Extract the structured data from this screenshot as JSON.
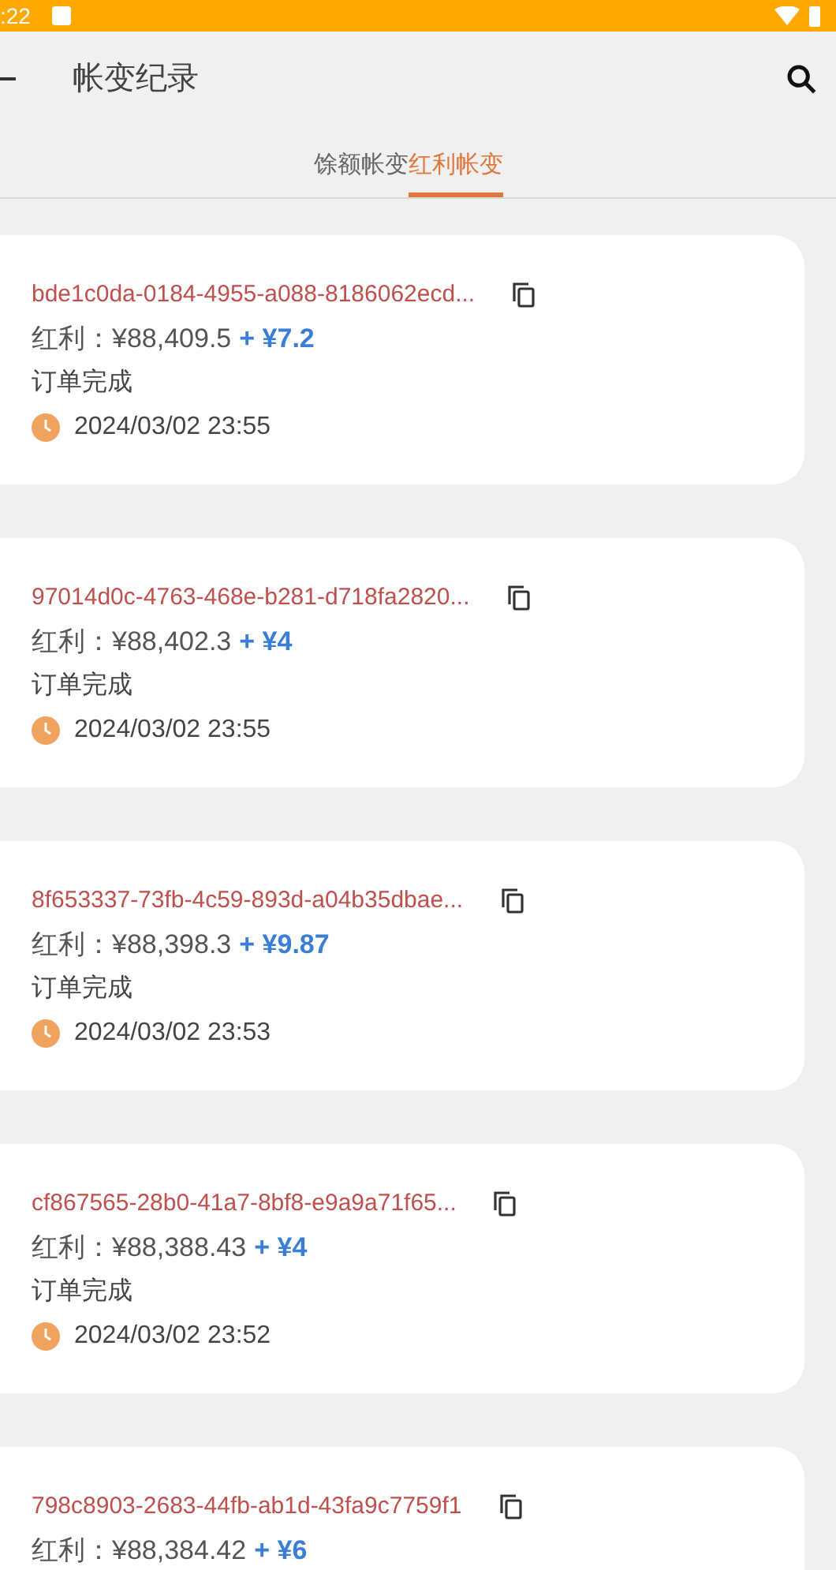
{
  "status_bar": {
    "time": ":22"
  },
  "header": {
    "title": "帐变纪录"
  },
  "tabs": [
    {
      "label": "馀额帐变",
      "selected": false
    },
    {
      "label": "红利帐变",
      "selected": true
    }
  ],
  "records": [
    {
      "id": "bde1c0da-0184-4955-a088-8186062ecd...",
      "label": "红利：",
      "balance": "¥88,409.5",
      "change": "+ ¥7.2",
      "status": "订单完成",
      "time": "2024/03/02 23:55"
    },
    {
      "id": "97014d0c-4763-468e-b281-d718fa2820...",
      "label": "红利：",
      "balance": "¥88,402.3",
      "change": "+ ¥4",
      "status": "订单完成",
      "time": "2024/03/02 23:55"
    },
    {
      "id": "8f653337-73fb-4c59-893d-a04b35dbae...",
      "label": "红利：",
      "balance": "¥88,398.3",
      "change": "+ ¥9.87",
      "status": "订单完成",
      "time": "2024/03/02 23:53"
    },
    {
      "id": "cf867565-28b0-41a7-8bf8-e9a9a71f65...",
      "label": "红利：",
      "balance": "¥88,388.43",
      "change": "+ ¥4",
      "status": "订单完成",
      "time": "2024/03/02 23:52"
    },
    {
      "id": "798c8903-2683-44fb-ab1d-43fa9c7759f1",
      "label": "红利：",
      "balance": "¥88,384.42",
      "change": "+ ¥6"
    }
  ]
}
